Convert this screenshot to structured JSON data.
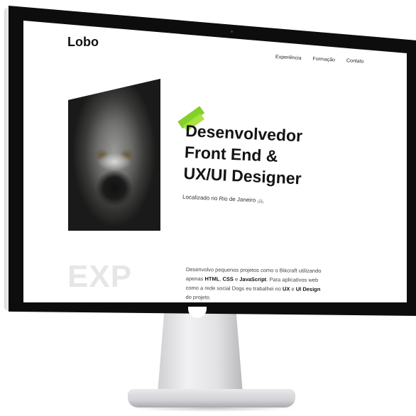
{
  "site": {
    "logo": "Lobo",
    "nav": [
      "Experiência",
      "Formação",
      "Contato"
    ]
  },
  "hero": {
    "title_lines": [
      "Desenvolvedor",
      "Front End &",
      "UX/UI Designer"
    ],
    "location": "Localizado no Rio de Janeiro",
    "location_icon": "bicycle-icon",
    "photo_alt": "wolf portrait"
  },
  "experience": {
    "watermark": "EXP",
    "bio_parts": {
      "p1": "Desenvolvo pequenos projetos como o Bikcraft utilizando apenas ",
      "html": "HTML",
      "sep1": ", ",
      "css": "CSS",
      "sep2": " e ",
      "js": "JavaScript",
      "p2": ". Para aplicativos web como a rede social Dogs eu trabalhei no ",
      "ux": "UX",
      "sep3": " e ",
      "ui": "UI Design",
      "p3": " do projeto."
    }
  },
  "colors": {
    "accent": "#7ccc21",
    "text": "#151515",
    "watermark": "#e6e6e6"
  }
}
